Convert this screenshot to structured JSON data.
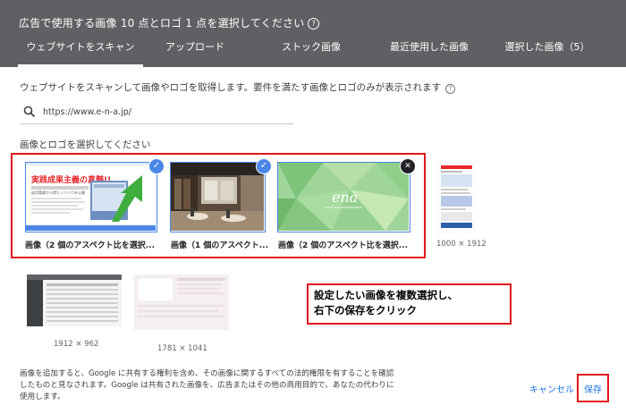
{
  "dialog": {
    "title": "広告で使用する画像 10 点とロゴ 1 点を選択してください",
    "tabs": [
      {
        "label": "ウェブサイトをスキャン",
        "active": true
      },
      {
        "label": "アップロード",
        "active": false
      },
      {
        "label": "ストック画像",
        "active": false
      },
      {
        "label": "最近使用した画像",
        "active": false
      },
      {
        "label": "選択した画像（5）",
        "active": false
      }
    ],
    "description": "ウェブサイトをスキャンして画像やロゴを取得します。要件を満たす画像とロゴのみが表示されます",
    "search": {
      "value": "https://www.e-n-a.jp/",
      "icon": "search-icon"
    },
    "section_label": "画像とロゴを選択してください",
    "cards": [
      {
        "label": "画像（2 個のアスペクト比を選択...",
        "state": "selected",
        "banner_text": "実践成果主義の真髄!!",
        "banner_sub": "成功実績から得たノウハウを公開"
      },
      {
        "label": "画像（1 個のアスペクト...",
        "state": "selected"
      },
      {
        "label": "画像（2 個のアスペクト比を選択...",
        "state": "removable"
      }
    ],
    "thumbnails": [
      {
        "size": "1000 × 1912"
      },
      {
        "size": "1912 × 962"
      },
      {
        "size": "1781 × 1041"
      }
    ],
    "annotation": [
      "設定したい画像を複数選択し、",
      "右下の保存をクリック"
    ],
    "footer_note": "画像を追加すると、Google に共有する権利を含め、その画像に関するすべての法的権限を有することを確認したものと見なされます。Google は共有された画像を、広告またはその他の商用目的で、あなたの代わりに使用します。",
    "buttons": {
      "cancel": "キャンセル",
      "save": "保存"
    },
    "colors": {
      "header": "#5f6063",
      "accent": "#4a86e8",
      "annotation_red": "#e0161c",
      "link": "#1a73e8"
    }
  }
}
